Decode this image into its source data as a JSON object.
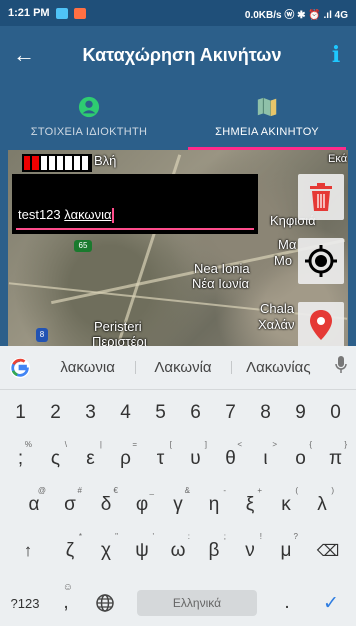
{
  "status": {
    "time": "1:21 PM",
    "right": "0.0KB/s ⓦ ✱ ⏰ .ıl 4G"
  },
  "toolbar": {
    "title": "Καταχώρηση Ακινήτων",
    "back": "←",
    "info": "i"
  },
  "tabs": [
    {
      "label": "ΣΤΟΙΧΕΙΑ ΙΔΙΟΚΤΗΤΗ",
      "icon": "person-icon",
      "active": false
    },
    {
      "label": "ΣΗΜΕΙΑ ΑΚΙΝΗΤΟΥ",
      "icon": "map-icon",
      "active": true
    }
  ],
  "map": {
    "places": [
      "Εκά",
      "Βλή",
      "Κηφισιά",
      "Μα",
      "Μο",
      "Nea Ionia",
      "Νέα Ιωνία",
      "Chala",
      "Χαλάν",
      "Peristeri",
      "Περιστέρι"
    ],
    "shields": [
      "65",
      "8"
    ]
  },
  "input": {
    "text": "test123 ",
    "typed_word": "λακωνια"
  },
  "suggestions": [
    "λακωνια",
    "Λακωνία",
    "Λακωνίας"
  ],
  "keyboard": {
    "numbers": [
      "1",
      "2",
      "3",
      "4",
      "5",
      "6",
      "7",
      "8",
      "9",
      "0"
    ],
    "row1": [
      {
        "k": ";",
        "h": "%"
      },
      {
        "k": "ς",
        "h": "\\"
      },
      {
        "k": "ε",
        "h": "|"
      },
      {
        "k": "ρ",
        "h": "="
      },
      {
        "k": "τ",
        "h": "["
      },
      {
        "k": "υ",
        "h": "]"
      },
      {
        "k": "θ",
        "h": "<"
      },
      {
        "k": "ι",
        "h": ">"
      },
      {
        "k": "ο",
        "h": "{"
      },
      {
        "k": "π",
        "h": "}"
      }
    ],
    "row2": [
      {
        "k": "α",
        "h": "@"
      },
      {
        "k": "σ",
        "h": "#"
      },
      {
        "k": "δ",
        "h": "€"
      },
      {
        "k": "φ",
        "h": "_"
      },
      {
        "k": "γ",
        "h": "&"
      },
      {
        "k": "η",
        "h": "-"
      },
      {
        "k": "ξ",
        "h": "+"
      },
      {
        "k": "κ",
        "h": "("
      },
      {
        "k": "λ",
        "h": ")"
      }
    ],
    "row3": [
      {
        "k": "ζ",
        "h": "*"
      },
      {
        "k": "χ",
        "h": "\""
      },
      {
        "k": "ψ",
        "h": "'"
      },
      {
        "k": "ω",
        "h": ":"
      },
      {
        "k": "β",
        "h": ";"
      },
      {
        "k": "ν",
        "h": "!"
      },
      {
        "k": "μ",
        "h": "?"
      }
    ],
    "shift": "↑",
    "backspace": "⌫",
    "symbols": "?123",
    "comma_hint": "☺",
    "comma": ",",
    "space": "Ελληνικά",
    "period": ".",
    "enter": "✓"
  },
  "colors": {
    "primary": "#2c5f8a",
    "accent": "#ff2b8a",
    "info": "#1ec8ff",
    "delete": "#e53935",
    "marker": "#e53935"
  }
}
